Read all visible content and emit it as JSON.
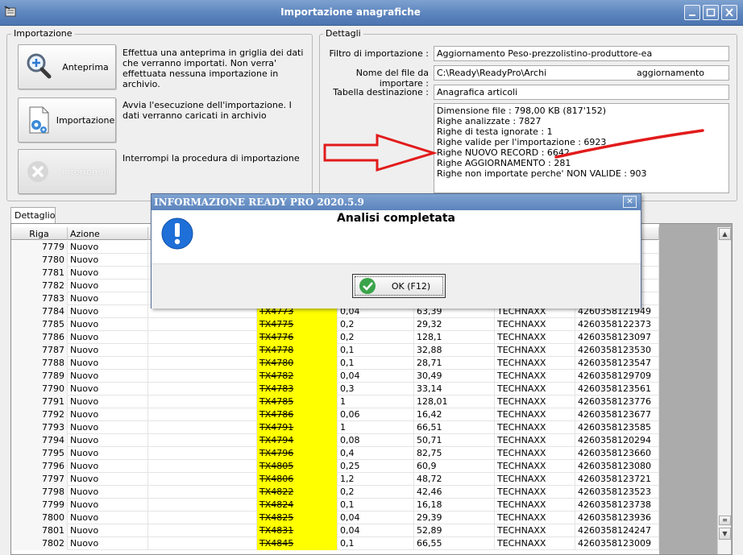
{
  "window": {
    "title": "Importazione anagrafiche"
  },
  "importazione": {
    "legend": "Importazione",
    "anteprima": {
      "label": "Anteprima",
      "desc": "Effettua una anteprima in griglia dei dati che verranno importati. Non verra' effettuata nessuna importazione in archivio."
    },
    "importa": {
      "label": "Importazione",
      "desc": "Avvia l'esecuzione dell'importazione. I dati verranno caricati in archivio"
    },
    "interrompi": {
      "label": "Interrompi",
      "desc": "Interrompi la procedura di importazione"
    }
  },
  "dettagli": {
    "legend": "Dettagli",
    "filtro_label": "Filtro di importazione :",
    "filtro_value": "Aggiornamento Peso-prezzolistino-produttore-ea",
    "file_label": "Nome del file da importare :",
    "file_value": "C:\\Ready\\ReadyPro\\Archi",
    "file_value_tail": "aggiornamento",
    "tabella_label": "Tabella destinazione :",
    "tabella_value": "Anagrafica articoli",
    "stats": [
      "Dimensione file : 798,00 KB (817'152)",
      "Righe analizzate : 7827",
      "Righe di testa ignorate : 1",
      "Righe valide per l'importazione : 6923",
      "Righe NUOVO RECORD : 6642",
      "Righe AGGIORNAMENTO  : 281",
      "Righe non importate perche' NON VALIDE : 903"
    ]
  },
  "tab": {
    "label": "Dettaglio"
  },
  "grid": {
    "headers": [
      "Riga",
      "Azione"
    ],
    "rows": [
      {
        "riga": "7779",
        "azione": "Nuovo",
        "codice": "",
        "peso": "",
        "prezzo": "",
        "produttore": "",
        "ean": ""
      },
      {
        "riga": "7780",
        "azione": "Nuovo",
        "codice": "",
        "peso": "",
        "prezzo": "",
        "produttore": "",
        "ean": ""
      },
      {
        "riga": "7781",
        "azione": "Nuovo",
        "codice": "",
        "peso": "",
        "prezzo": "",
        "produttore": "",
        "ean": ""
      },
      {
        "riga": "7782",
        "azione": "Nuovo",
        "codice": "",
        "peso": "",
        "prezzo": "",
        "produttore": "",
        "ean": ""
      },
      {
        "riga": "7783",
        "azione": "Nuovo",
        "codice": "",
        "peso": "",
        "prezzo": "",
        "produttore": "",
        "ean": ""
      },
      {
        "riga": "7784",
        "azione": "Nuovo",
        "codice": "TX4773",
        "peso": "0,04",
        "prezzo": "63,39",
        "produttore": "TECHNAXX",
        "ean": "4260358121949"
      },
      {
        "riga": "7785",
        "azione": "Nuovo",
        "codice": "TX4775",
        "peso": "0,2",
        "prezzo": "29,32",
        "produttore": "TECHNAXX",
        "ean": "4260358122373"
      },
      {
        "riga": "7786",
        "azione": "Nuovo",
        "codice": "TX4776",
        "peso": "0,2",
        "prezzo": "128,1",
        "produttore": "TECHNAXX",
        "ean": "4260358123097"
      },
      {
        "riga": "7787",
        "azione": "Nuovo",
        "codice": "TX4778",
        "peso": "0,1",
        "prezzo": "32,88",
        "produttore": "TECHNAXX",
        "ean": "4260358123530"
      },
      {
        "riga": "7788",
        "azione": "Nuovo",
        "codice": "TX4780",
        "peso": "0,1",
        "prezzo": "28,71",
        "produttore": "TECHNAXX",
        "ean": "4260358123547"
      },
      {
        "riga": "7789",
        "azione": "Nuovo",
        "codice": "TX4782",
        "peso": "0,04",
        "prezzo": "30,49",
        "produttore": "TECHNAXX",
        "ean": "4260358129709"
      },
      {
        "riga": "7790",
        "azione": "Nuovo",
        "codice": "TX4783",
        "peso": "0,3",
        "prezzo": "33,14",
        "produttore": "TECHNAXX",
        "ean": "4260358123561"
      },
      {
        "riga": "7791",
        "azione": "Nuovo",
        "codice": "TX4785",
        "peso": "1",
        "prezzo": "128,01",
        "produttore": "TECHNAXX",
        "ean": "4260358123776"
      },
      {
        "riga": "7792",
        "azione": "Nuovo",
        "codice": "TX4786",
        "peso": "0,06",
        "prezzo": "16,42",
        "produttore": "TECHNAXX",
        "ean": "4260358123677"
      },
      {
        "riga": "7793",
        "azione": "Nuovo",
        "codice": "TX4791",
        "peso": "1",
        "prezzo": "66,51",
        "produttore": "TECHNAXX",
        "ean": "4260358123585"
      },
      {
        "riga": "7794",
        "azione": "Nuovo",
        "codice": "TX4794",
        "peso": "0,08",
        "prezzo": "50,71",
        "produttore": "TECHNAXX",
        "ean": "4260358120294"
      },
      {
        "riga": "7795",
        "azione": "Nuovo",
        "codice": "TX4796",
        "peso": "0,4",
        "prezzo": "82,75",
        "produttore": "TECHNAXX",
        "ean": "4260358123660"
      },
      {
        "riga": "7796",
        "azione": "Nuovo",
        "codice": "TX4805",
        "peso": "0,25",
        "prezzo": "60,9",
        "produttore": "TECHNAXX",
        "ean": "4260358123080"
      },
      {
        "riga": "7797",
        "azione": "Nuovo",
        "codice": "TX4806",
        "peso": "1,2",
        "prezzo": "48,72",
        "produttore": "TECHNAXX",
        "ean": "4260358123721"
      },
      {
        "riga": "7798",
        "azione": "Nuovo",
        "codice": "TX4822",
        "peso": "0,2",
        "prezzo": "42,46",
        "produttore": "TECHNAXX",
        "ean": "4260358123523"
      },
      {
        "riga": "7799",
        "azione": "Nuovo",
        "codice": "TX4824",
        "peso": "0,1",
        "prezzo": "16,18",
        "produttore": "TECHNAXX",
        "ean": "4260358123738"
      },
      {
        "riga": "7800",
        "azione": "Nuovo",
        "codice": "TX4825",
        "peso": "0,04",
        "prezzo": "29,39",
        "produttore": "TECHNAXX",
        "ean": "4260358123936"
      },
      {
        "riga": "7801",
        "azione": "Nuovo",
        "codice": "TX4831",
        "peso": "0,04",
        "prezzo": "52,89",
        "produttore": "TECHNAXX",
        "ean": "4260358124247"
      },
      {
        "riga": "7802",
        "azione": "Nuovo",
        "codice": "TX4845",
        "peso": "0,1",
        "prezzo": "66,55",
        "produttore": "TECHNAXX",
        "ean": "4260358123009"
      }
    ]
  },
  "dialog": {
    "title": "INFORMAZIONE READY PRO 2020.5.9",
    "message": "Analisi completata",
    "ok_label": "OK (F12)",
    "close_glyph": "✕"
  },
  "annotation_colors": {
    "arrow": "#e21b1b",
    "highlight": "#ffff00"
  }
}
